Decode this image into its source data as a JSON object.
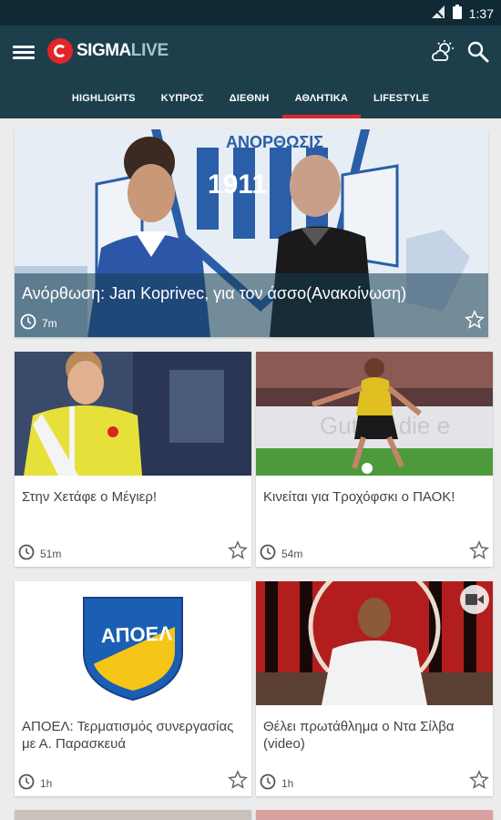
{
  "status_bar": {
    "time": "1:37",
    "icons": [
      "signal-icon",
      "battery-icon"
    ]
  },
  "app": {
    "logo_sigma": "SIGMA",
    "logo_live": "LIVE",
    "brand_color": "#e2252a",
    "bar_color": "#1c3f4b"
  },
  "tabs": [
    {
      "label": "HIGHLIGHTS",
      "active": false
    },
    {
      "label": "ΚΥΠΡΟΣ",
      "active": false
    },
    {
      "label": "ΔΙΕΘΝΗ",
      "active": false
    },
    {
      "label": "ΑΘΛΗΤΙΚΑ",
      "active": true
    },
    {
      "label": "LIFESTYLE",
      "active": false
    }
  ],
  "hero": {
    "title": "Ανόρθωση: Jan Koprivec, για τον άσσο(Ανακοίνωση)",
    "time": "7m",
    "image_text": {
      "club": "ΑΝΟΡΘΩΣΙΣ",
      "year": "1911"
    }
  },
  "articles": [
    {
      "title": "Στην Χετάφε ο Μέγιερ!",
      "time": "51m"
    },
    {
      "title": "Κινείται για Τροχόφσκι ο ΠΑΟΚ!",
      "time": "54m",
      "image_text": "Gut für die e"
    },
    {
      "title": "ΑΠΟΕΛ: Τερματισμός συνεργασίας με Α. Παρασκευά",
      "time": "1h",
      "image_text": "ΑΠΟΕΛ"
    },
    {
      "title": "Θέλει πρωτάθλημα ο Ντα Σίλβα (video)",
      "time": "1h"
    }
  ]
}
